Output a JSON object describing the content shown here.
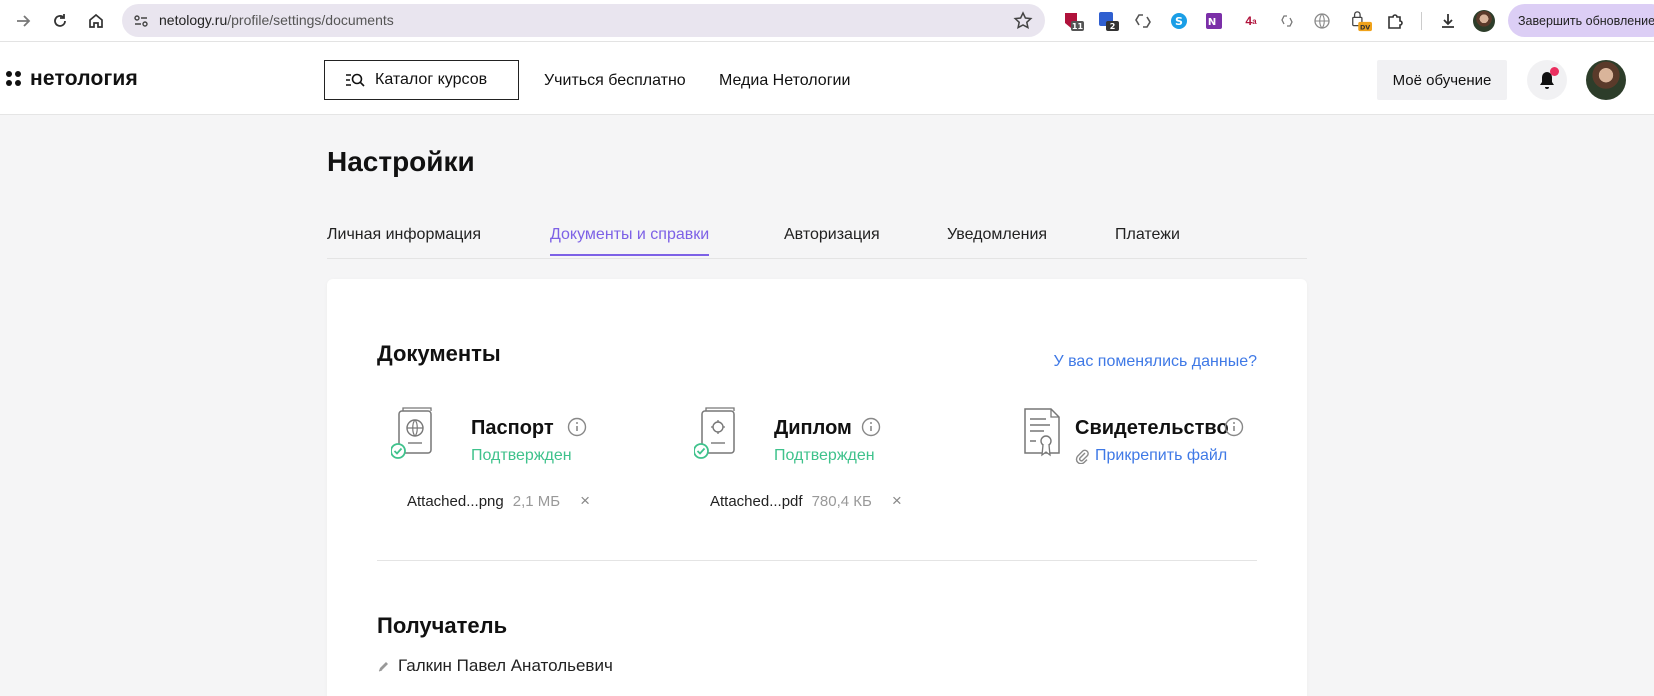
{
  "browser": {
    "url_host": "netology.ru",
    "url_path": "/profile/settings/documents",
    "ext_badge_1": "11",
    "ext_badge_2": "2",
    "ext_four": "4",
    "ext_dv": "DV",
    "update_label": "Завершить обновление"
  },
  "header": {
    "logo_text": "нетология",
    "catalog_label": "Каталог курсов",
    "links": [
      "Учиться бесплатно",
      "Медиа Нетологии"
    ],
    "my_learning_label": "Моё обучение"
  },
  "page": {
    "title": "Настройки",
    "tabs": [
      {
        "label": "Личная информация"
      },
      {
        "label": "Документы и справки",
        "active": true
      },
      {
        "label": "Авторизация"
      },
      {
        "label": "Уведомления"
      },
      {
        "label": "Платежи"
      }
    ]
  },
  "documents": {
    "title": "Документы",
    "changed_link": "У вас поменялись данные?",
    "items": [
      {
        "name": "Паспорт",
        "status": "Подтвержден",
        "file_name": "Attached...png",
        "file_size": "2,1 МБ",
        "remove": "×"
      },
      {
        "name": "Диплом",
        "status": "Подтвержден",
        "file_name": "Attached...pdf",
        "file_size": "780,4 КБ",
        "remove": "×"
      },
      {
        "name": "Свидетельство",
        "attach_label": "Прикрепить файл"
      }
    ]
  },
  "recipient": {
    "title": "Получатель",
    "name": "Галкин Павел Анатольевич"
  },
  "colors": {
    "accent": "#7d61e6",
    "link": "#3f79e6",
    "success": "#3fc28c",
    "notification": "#ea2f5f"
  }
}
